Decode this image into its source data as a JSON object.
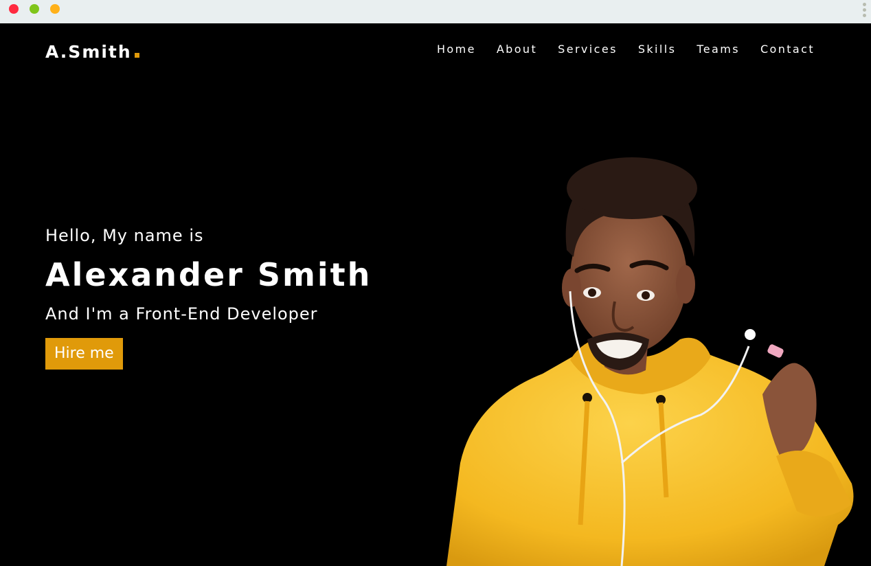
{
  "colors": {
    "accent": "#e09a0a",
    "window_close": "#ff2a3f",
    "window_maximize": "#7fc51a",
    "window_minimize": "#ffb11a",
    "hoodie": "#f7c131",
    "skin": "#8a543a",
    "hair": "#2a1a14"
  },
  "brand": {
    "logo": "A.Smith"
  },
  "nav": {
    "items": [
      {
        "label": "Home"
      },
      {
        "label": "About"
      },
      {
        "label": "Services"
      },
      {
        "label": "Skills"
      },
      {
        "label": "Teams"
      },
      {
        "label": "Contact"
      }
    ]
  },
  "hero": {
    "greeting": "Hello, My name is",
    "name": "Alexander Smith",
    "role": "And I'm a Front-End Developer",
    "cta_label": "Hire me"
  }
}
